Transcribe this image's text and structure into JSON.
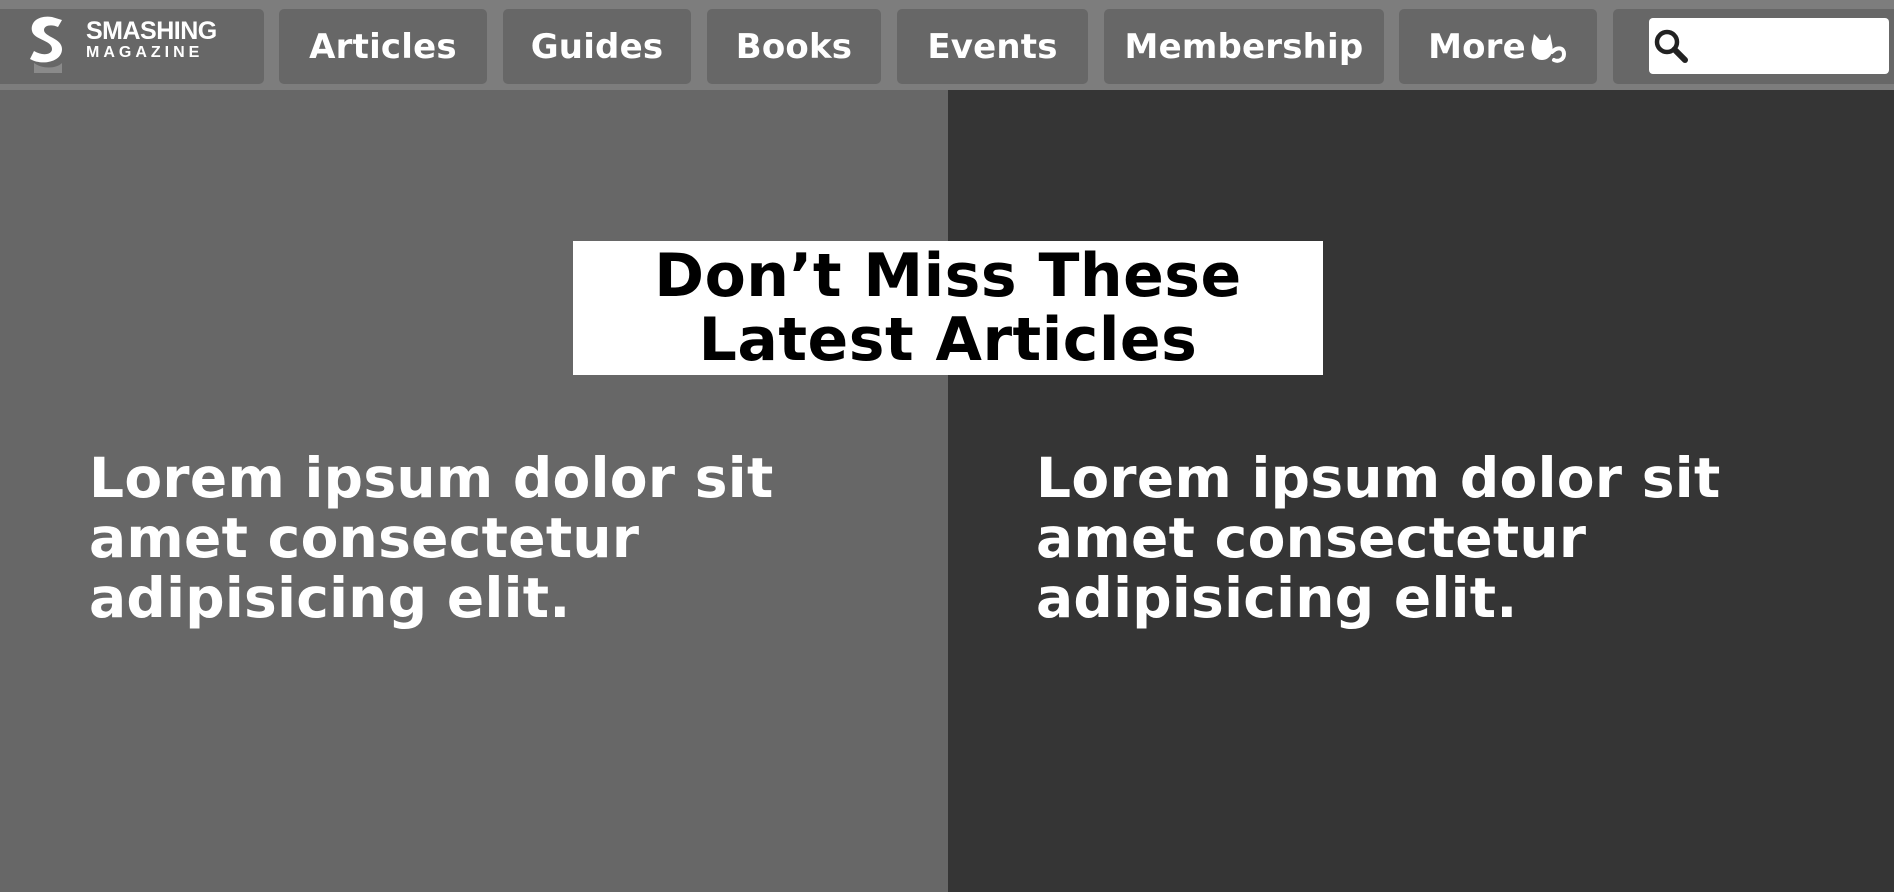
{
  "brand": {
    "name_line1": "SMASHING",
    "name_line2": "MAGAZINE"
  },
  "nav": {
    "items": [
      {
        "label": "Articles"
      },
      {
        "label": "Guides"
      },
      {
        "label": "Books"
      },
      {
        "label": "Events"
      },
      {
        "label": "Membership"
      },
      {
        "label": "More"
      }
    ],
    "more_icon": "cat-icon"
  },
  "search": {
    "icon": "search-icon",
    "value": "",
    "placeholder": ""
  },
  "hero": {
    "title_line1": "Don’t Miss These",
    "title_line2": "Latest Articles"
  },
  "articles": [
    {
      "title": "Lorem ipsum dolor sit amet consectetur adipisicing elit."
    },
    {
      "title": "Lorem ipsum dolor sit amet consectetur adipisicing elit."
    }
  ],
  "colors": {
    "topbar": "#7d7d7d",
    "tile": "#676767",
    "panel_left": "#676767",
    "panel_right": "#353535",
    "hero_bg": "#ffffff",
    "text": "#ffffff"
  }
}
